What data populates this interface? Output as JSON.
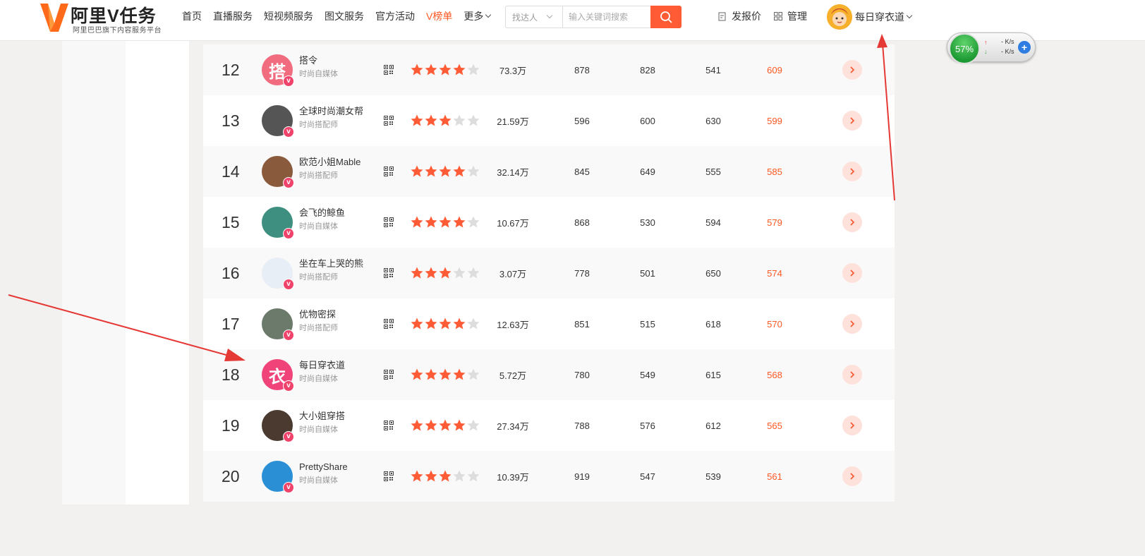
{
  "logo": {
    "title": "阿里V任务",
    "subtitle": "阿里巴巴旗下内容服务平台"
  },
  "nav": [
    {
      "label": "首页",
      "active": false
    },
    {
      "label": "直播服务",
      "active": false
    },
    {
      "label": "短视频服务",
      "active": false
    },
    {
      "label": "图文服务",
      "active": false
    },
    {
      "label": "官方活动",
      "active": false
    },
    {
      "label": "V榜单",
      "active": true
    }
  ],
  "nav_more": "更多",
  "search": {
    "type_label": "找达人",
    "placeholder": "输入关键词搜索",
    "value": ""
  },
  "header_links": {
    "quote": "发报价",
    "manage": "管理"
  },
  "user": {
    "name": "每日穿衣道"
  },
  "speed_widget": {
    "percent": "57%",
    "up": "- K/s",
    "down": "- K/s"
  },
  "colors": {
    "accent": "#ff5722",
    "star_on": "#ff5b35",
    "star_off": "#dddddd",
    "badge": "#f0436b"
  },
  "rows": [
    {
      "rank": "12",
      "name": "搭令",
      "category": "时尚自媒体",
      "rating": 4,
      "fans": "73.3万",
      "m1": "878",
      "m2": "828",
      "m3": "541",
      "score": "609",
      "avatar_glyph": "搭",
      "avatar_color": "#f06c7e"
    },
    {
      "rank": "13",
      "name": "全球时尚潮女帮",
      "category": "时尚搭配师",
      "rating": 3,
      "fans": "21.59万",
      "m1": "596",
      "m2": "600",
      "m3": "630",
      "score": "599",
      "avatar_glyph": "",
      "avatar_color": "#555555"
    },
    {
      "rank": "14",
      "name": "欧范小姐Mable",
      "category": "时尚搭配师",
      "rating": 4,
      "fans": "32.14万",
      "m1": "845",
      "m2": "649",
      "m3": "555",
      "score": "585",
      "avatar_glyph": "",
      "avatar_color": "#8a5a3c"
    },
    {
      "rank": "15",
      "name": "会飞的鲸鱼",
      "category": "时尚自媒体",
      "rating": 4,
      "fans": "10.67万",
      "m1": "868",
      "m2": "530",
      "m3": "594",
      "score": "579",
      "avatar_glyph": "",
      "avatar_color": "#3f8f80"
    },
    {
      "rank": "16",
      "name": "坐在车上哭的熊",
      "category": "时尚搭配师",
      "rating": 3,
      "fans": "3.07万",
      "m1": "778",
      "m2": "501",
      "m3": "650",
      "score": "574",
      "avatar_glyph": "",
      "avatar_color": "#e8eef5"
    },
    {
      "rank": "17",
      "name": "优物密探",
      "category": "时尚搭配师",
      "rating": 4,
      "fans": "12.63万",
      "m1": "851",
      "m2": "515",
      "m3": "618",
      "score": "570",
      "avatar_glyph": "",
      "avatar_color": "#6b7a6a"
    },
    {
      "rank": "18",
      "name": "每日穿衣道",
      "category": "时尚自媒体",
      "rating": 4,
      "fans": "5.72万",
      "m1": "780",
      "m2": "549",
      "m3": "615",
      "score": "568",
      "avatar_glyph": "衣",
      "avatar_color": "#f0437a"
    },
    {
      "rank": "19",
      "name": "大小姐穿搭",
      "category": "时尚自媒体",
      "rating": 4,
      "fans": "27.34万",
      "m1": "788",
      "m2": "576",
      "m3": "612",
      "score": "565",
      "avatar_glyph": "",
      "avatar_color": "#4a3a30"
    },
    {
      "rank": "20",
      "name": "PrettyShare",
      "category": "时尚自媒体",
      "rating": 3,
      "fans": "10.39万",
      "m1": "919",
      "m2": "547",
      "m3": "539",
      "score": "561",
      "avatar_glyph": "",
      "avatar_color": "#2b8fd6"
    }
  ]
}
